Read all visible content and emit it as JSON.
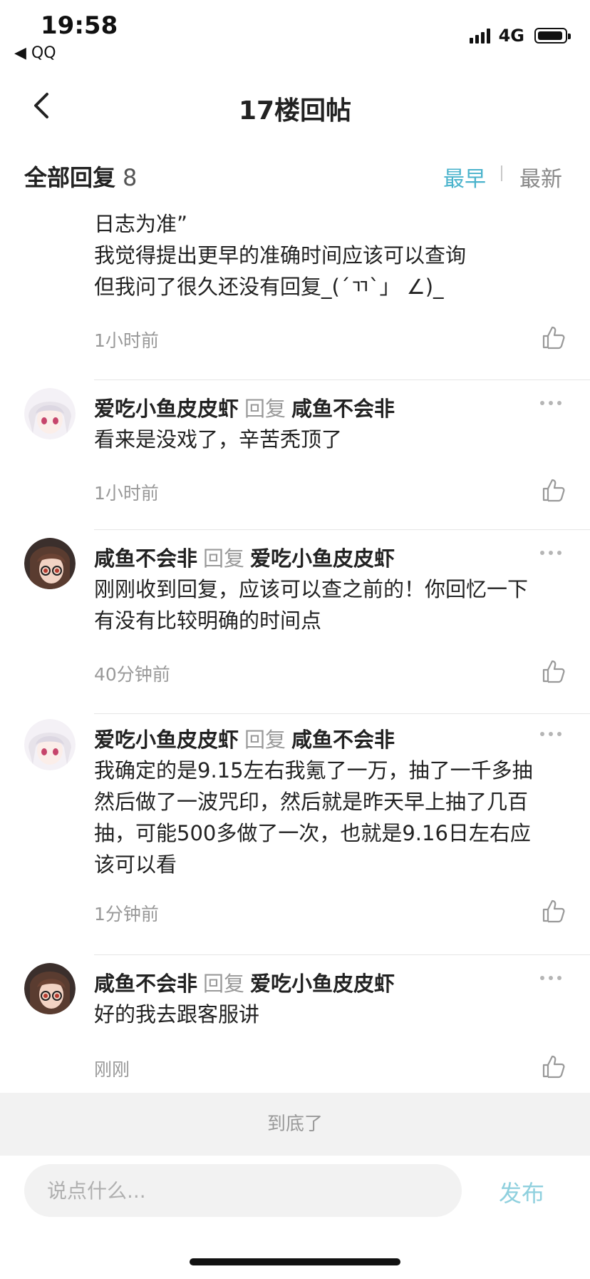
{
  "status_bar": {
    "time": "19:58",
    "back_app": "◀ QQ",
    "network": "4G"
  },
  "header": {
    "title": "17楼回帖"
  },
  "filter": {
    "label": "全部回复",
    "count": "8",
    "sort_earliest": "最早",
    "sort_latest": "最新",
    "active": "最早",
    "active_color": "#4ab3cc"
  },
  "partial_comment": {
    "lines": [
      "日志为准”",
      "我觉得提出更早的准确时间应该可以查询",
      "但我问了很久还没有回复_(´ㄲ`」 ∠)_"
    ],
    "time": "1小时前"
  },
  "comments": [
    {
      "author": "爱吃小鱼皮皮虾",
      "reply_word": "回复",
      "reply_to": "咸鱼不会非",
      "lines": [
        "看来是没戏了，辛苦秃顶了"
      ],
      "time": "1小时前",
      "avatar": "white-hair-anime-girl"
    },
    {
      "author": "咸鱼不会非",
      "reply_word": "回复",
      "reply_to": "爱吃小鱼皮皮虾",
      "lines": [
        "刚刚收到回复，应该可以查之前的！你回忆一下",
        "有没有比较明确的时间点"
      ],
      "time": "40分钟前",
      "avatar": "dark-hair-anime-girl-glasses"
    },
    {
      "author": "爱吃小鱼皮皮虾",
      "reply_word": "回复",
      "reply_to": "咸鱼不会非",
      "lines": [
        "我确定的是9.15左右我氪了一万，抽了一千多抽",
        "然后做了一波咒印，然后就是昨天早上抽了几百",
        "抽，可能500多做了一次，也就是9.16日左右应",
        "该可以看"
      ],
      "time": "1分钟前",
      "avatar": "white-hair-anime-girl"
    },
    {
      "author": "咸鱼不会非",
      "reply_word": "回复",
      "reply_to": "爱吃小鱼皮皮虾",
      "lines": [
        "好的我去跟客服讲"
      ],
      "time": "刚刚",
      "avatar": "dark-hair-anime-girl-glasses"
    }
  ],
  "footer": {
    "end_text": "到底了",
    "input_placeholder": "说点什么...",
    "publish_label": "发布",
    "publish_color": "#8fd0de"
  }
}
